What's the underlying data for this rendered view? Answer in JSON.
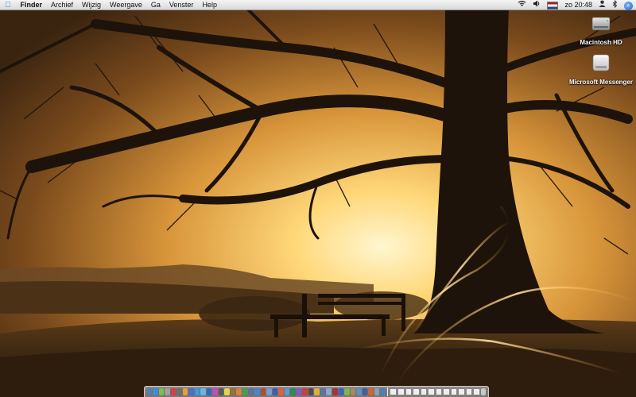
{
  "menubar": {
    "apple_glyph": "",
    "app_name": "Finder",
    "menus": [
      "Archief",
      "Wijzig",
      "Weergave",
      "Ga",
      "Venster",
      "Help"
    ],
    "status": {
      "icons": [
        "wifi-icon",
        "volume-icon",
        "flag-nl-icon",
        "user-icon",
        "bluetooth-icon",
        "spotlight-icon"
      ],
      "clock": "zo 20:48"
    }
  },
  "desktop": {
    "icons": [
      {
        "label": "Macintosh HD",
        "icon": "hard-drive-icon"
      },
      {
        "label": "Microsoft Messenger",
        "icon": "disk-image-icon"
      }
    ]
  },
  "dock": {
    "app_colors": [
      "#5b7fa6",
      "#3a8edb",
      "#7fbf4d",
      "#a0a0a0",
      "#d94040",
      "#6e6e6e",
      "#e6a32b",
      "#4a70c9",
      "#3d9be0",
      "#6bb5e8",
      "#2f6fb5",
      "#c04fb8",
      "#5a5a5a",
      "#e8d34a",
      "#9a7040",
      "#d9813b",
      "#3fa34d",
      "#6070a0",
      "#4488cc",
      "#b05030",
      "#7a9ad0",
      "#3b5fb0",
      "#e06040",
      "#50a0d0",
      "#2e8b57",
      "#8855cc",
      "#c94040",
      "#4d4d4d",
      "#dfb040",
      "#5577aa",
      "#88aacc",
      "#aa3333",
      "#3366cc",
      "#77bb44",
      "#b08850",
      "#6090c0",
      "#4060a0",
      "#cc6633",
      "#8fa0b0",
      "#5080b0"
    ],
    "minimized_windows": 12
  },
  "colors": {
    "menubar": "#e6e6e6",
    "sky_glow": "#ffd27a",
    "tree": "#1e130a",
    "light_streak": "#ffb347"
  }
}
